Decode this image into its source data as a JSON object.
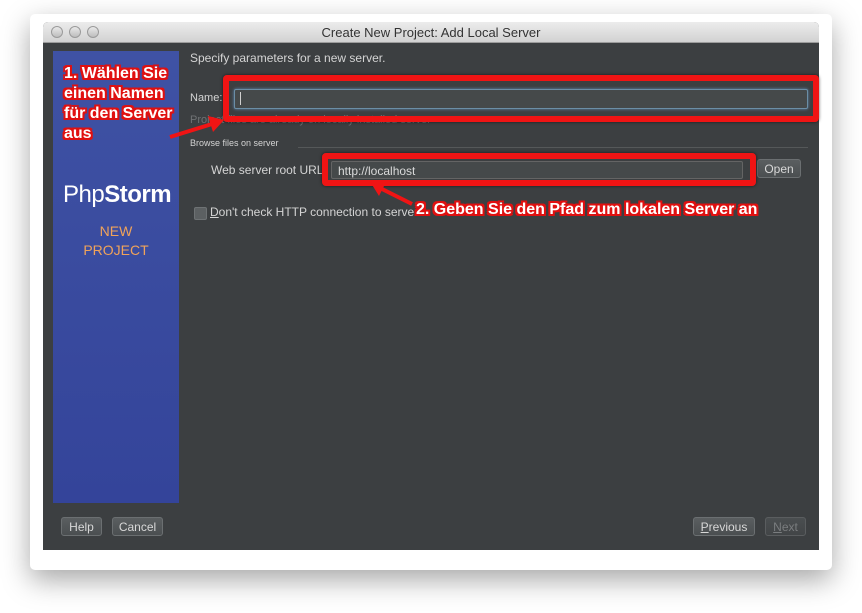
{
  "window": {
    "title": "Create New Project: Add Local Server"
  },
  "sidebar": {
    "brand_light": "Php",
    "brand_bold": "Storm",
    "new_line1": "NEW",
    "new_line2": "PROJECT"
  },
  "form": {
    "header": "Specify parameters for a new server.",
    "name_label": "Name:",
    "name_value": "",
    "hint": "Project files are already on locally installed server",
    "section_label": "Browse files on server",
    "url_label": "Web server root URL:",
    "url_value": "http://localhost",
    "open_button": "Open",
    "checkbox_prefix": "D",
    "checkbox_label": "on't check HTTP connection to server"
  },
  "footer": {
    "help": "Help",
    "cancel": "Cancel",
    "previous_u": "P",
    "previous_rest": "revious",
    "next_u": "N",
    "next_rest": "ext"
  },
  "annotations": {
    "step1_line1": "1. Wählen Sie",
    "step1_line2": "einen Namen",
    "step1_line3": "für den Server",
    "step1_line4": "aus",
    "step2": "2. Geben Sie den Pfad zum lokalen Server an",
    "color": "#f01414"
  }
}
